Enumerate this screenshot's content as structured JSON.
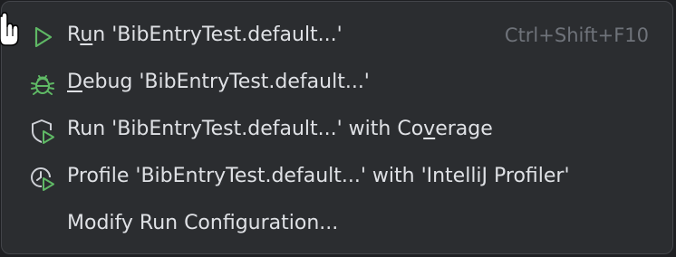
{
  "menu": {
    "items": [
      {
        "icon": "run-icon",
        "pre": "R",
        "mnemonic": "u",
        "post": "n 'BibEntryTest.default...'",
        "shortcut": "Ctrl+Shift+F10"
      },
      {
        "icon": "debug-icon",
        "pre": "",
        "mnemonic": "D",
        "post": "ebug 'BibEntryTest.default...'",
        "shortcut": ""
      },
      {
        "icon": "coverage-icon",
        "pre": "Run 'BibEntryTest.default...' with Co",
        "mnemonic": "v",
        "post": "erage",
        "shortcut": ""
      },
      {
        "icon": "profiler-icon",
        "pre": "Profile 'BibEntryTest.default...' with 'IntelliJ Profiler'",
        "mnemonic": "",
        "post": "",
        "shortcut": ""
      },
      {
        "icon": "",
        "pre": "Modify Run Configuration...",
        "mnemonic": "",
        "post": "",
        "shortcut": ""
      }
    ]
  },
  "colors": {
    "background": "#2b2d30",
    "text": "#dfe1e5",
    "shortcut": "#6f737a",
    "icon_green": "#5fb865",
    "icon_gray": "#ced0d6"
  }
}
